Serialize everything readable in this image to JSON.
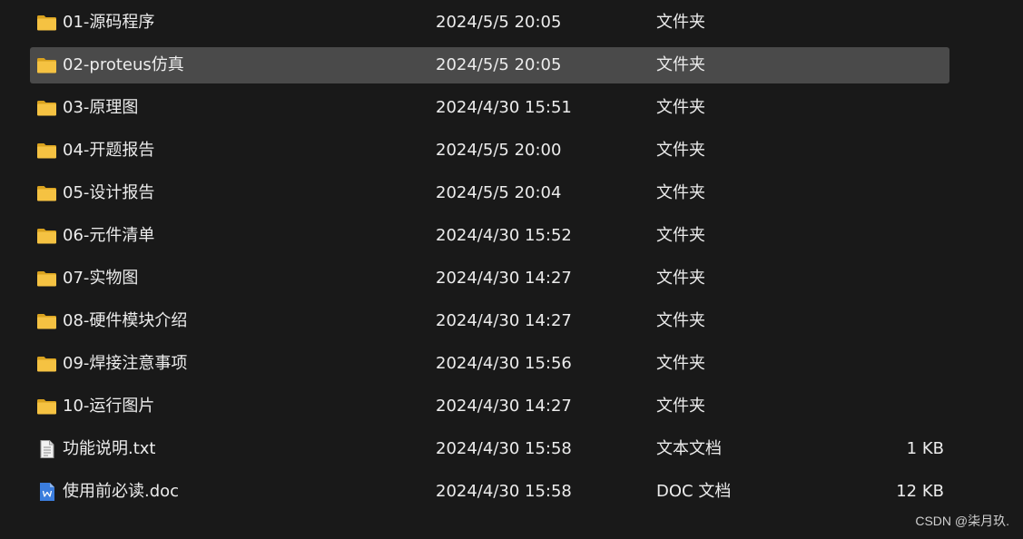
{
  "files": [
    {
      "name": "01-源码程序",
      "date": "2024/5/5 20:05",
      "type": "文件夹",
      "size": "",
      "icon": "folder-icon",
      "selected": false
    },
    {
      "name": "02-proteus仿真",
      "date": "2024/5/5 20:05",
      "type": "文件夹",
      "size": "",
      "icon": "folder-icon",
      "selected": true
    },
    {
      "name": "03-原理图",
      "date": "2024/4/30 15:51",
      "type": "文件夹",
      "size": "",
      "icon": "folder-icon",
      "selected": false
    },
    {
      "name": "04-开题报告",
      "date": "2024/5/5 20:00",
      "type": "文件夹",
      "size": "",
      "icon": "folder-icon",
      "selected": false
    },
    {
      "name": "05-设计报告",
      "date": "2024/5/5 20:04",
      "type": "文件夹",
      "size": "",
      "icon": "folder-icon",
      "selected": false
    },
    {
      "name": "06-元件清单",
      "date": "2024/4/30 15:52",
      "type": "文件夹",
      "size": "",
      "icon": "folder-icon",
      "selected": false
    },
    {
      "name": "07-实物图",
      "date": "2024/4/30 14:27",
      "type": "文件夹",
      "size": "",
      "icon": "folder-icon",
      "selected": false
    },
    {
      "name": "08-硬件模块介绍",
      "date": "2024/4/30 14:27",
      "type": "文件夹",
      "size": "",
      "icon": "folder-icon",
      "selected": false
    },
    {
      "name": "09-焊接注意事项",
      "date": "2024/4/30 15:56",
      "type": "文件夹",
      "size": "",
      "icon": "folder-icon",
      "selected": false
    },
    {
      "name": "10-运行图片",
      "date": "2024/4/30 14:27",
      "type": "文件夹",
      "size": "",
      "icon": "folder-icon",
      "selected": false
    },
    {
      "name": "功能说明.txt",
      "date": "2024/4/30 15:58",
      "type": "文本文档",
      "size": "1 KB",
      "icon": "text-file-icon",
      "selected": false
    },
    {
      "name": "使用前必读.doc",
      "date": "2024/4/30 15:58",
      "type": "DOC 文档",
      "size": "12 KB",
      "icon": "word-doc-icon",
      "selected": false
    }
  ],
  "watermark": "CSDN @柒月玖.",
  "colors": {
    "background": "#191919",
    "selected_row": "#4a4a4a",
    "text": "#ececec",
    "folder": "#f5c242",
    "doc_blue": "#3b7ddd"
  }
}
